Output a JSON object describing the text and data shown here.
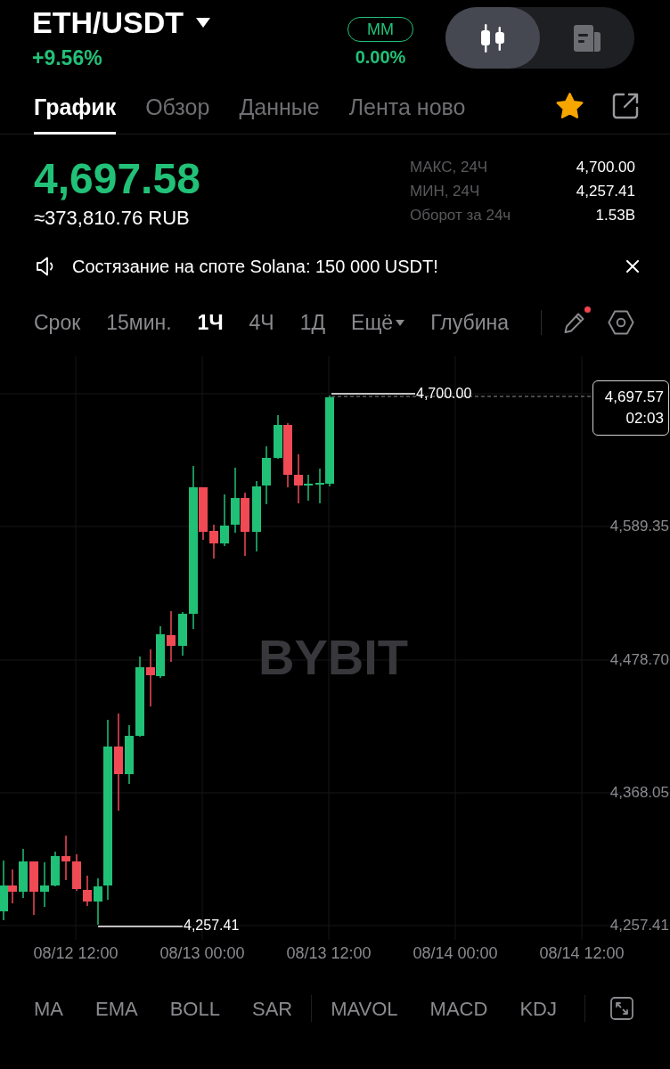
{
  "header": {
    "pair": "ETH/USDT",
    "change": "+9.56%",
    "mm": {
      "label": "MM",
      "value": "0.00%"
    },
    "view_toggle": [
      {
        "kind": "chart",
        "selected": true
      },
      {
        "kind": "document",
        "selected": false
      }
    ]
  },
  "tab_bar": {
    "tabs": [
      {
        "label": "График",
        "selected": true
      },
      {
        "label": "Обзор",
        "selected": false
      },
      {
        "label": "Данные",
        "selected": false
      },
      {
        "label": "Лента ново",
        "selected": false
      }
    ],
    "favorited": true
  },
  "price": {
    "last": "4,697.58",
    "converted": "≈373,810.76 RUB"
  },
  "stats": [
    {
      "label": "МАКС, 24Ч",
      "value": "4,700.00"
    },
    {
      "label": "МИН, 24Ч",
      "value": "4,257.41"
    },
    {
      "label": "Оборот за 24ч",
      "value": "1.53B"
    }
  ],
  "announcement": {
    "text": "Состязание на споте Solana: 150 000 USDT!"
  },
  "timeframe_bar": {
    "items": [
      {
        "label": "Срок",
        "kind": "option",
        "selected": false
      },
      {
        "label": "15мин.",
        "kind": "option",
        "selected": false
      },
      {
        "label": "1Ч",
        "kind": "option",
        "selected": true
      },
      {
        "label": "4Ч",
        "kind": "option",
        "selected": false
      },
      {
        "label": "1Д",
        "kind": "option",
        "selected": false
      },
      {
        "label": "Ещё",
        "kind": "dropdown",
        "selected": false
      },
      {
        "label": "Глубина",
        "kind": "option",
        "selected": false
      }
    ],
    "drawing_alert": true
  },
  "chart": {
    "watermark": "BYBIT",
    "y_axis": [
      "4,589.35",
      "4,478.70",
      "4,368.05",
      "4,257.41"
    ],
    "x_axis": [
      "08/12 12:00",
      "08/13 00:00",
      "08/13 12:00",
      "08/14 00:00",
      "08/14 12:00"
    ],
    "high_label": "4,700.00",
    "low_label": "4,257.41",
    "last_price": "4,697.57",
    "countdown": "02:03"
  },
  "indicators": {
    "main": [
      "MA",
      "EMA",
      "BOLL",
      "SAR"
    ],
    "sub": [
      "MAVOL",
      "MACD",
      "KDJ"
    ]
  }
}
